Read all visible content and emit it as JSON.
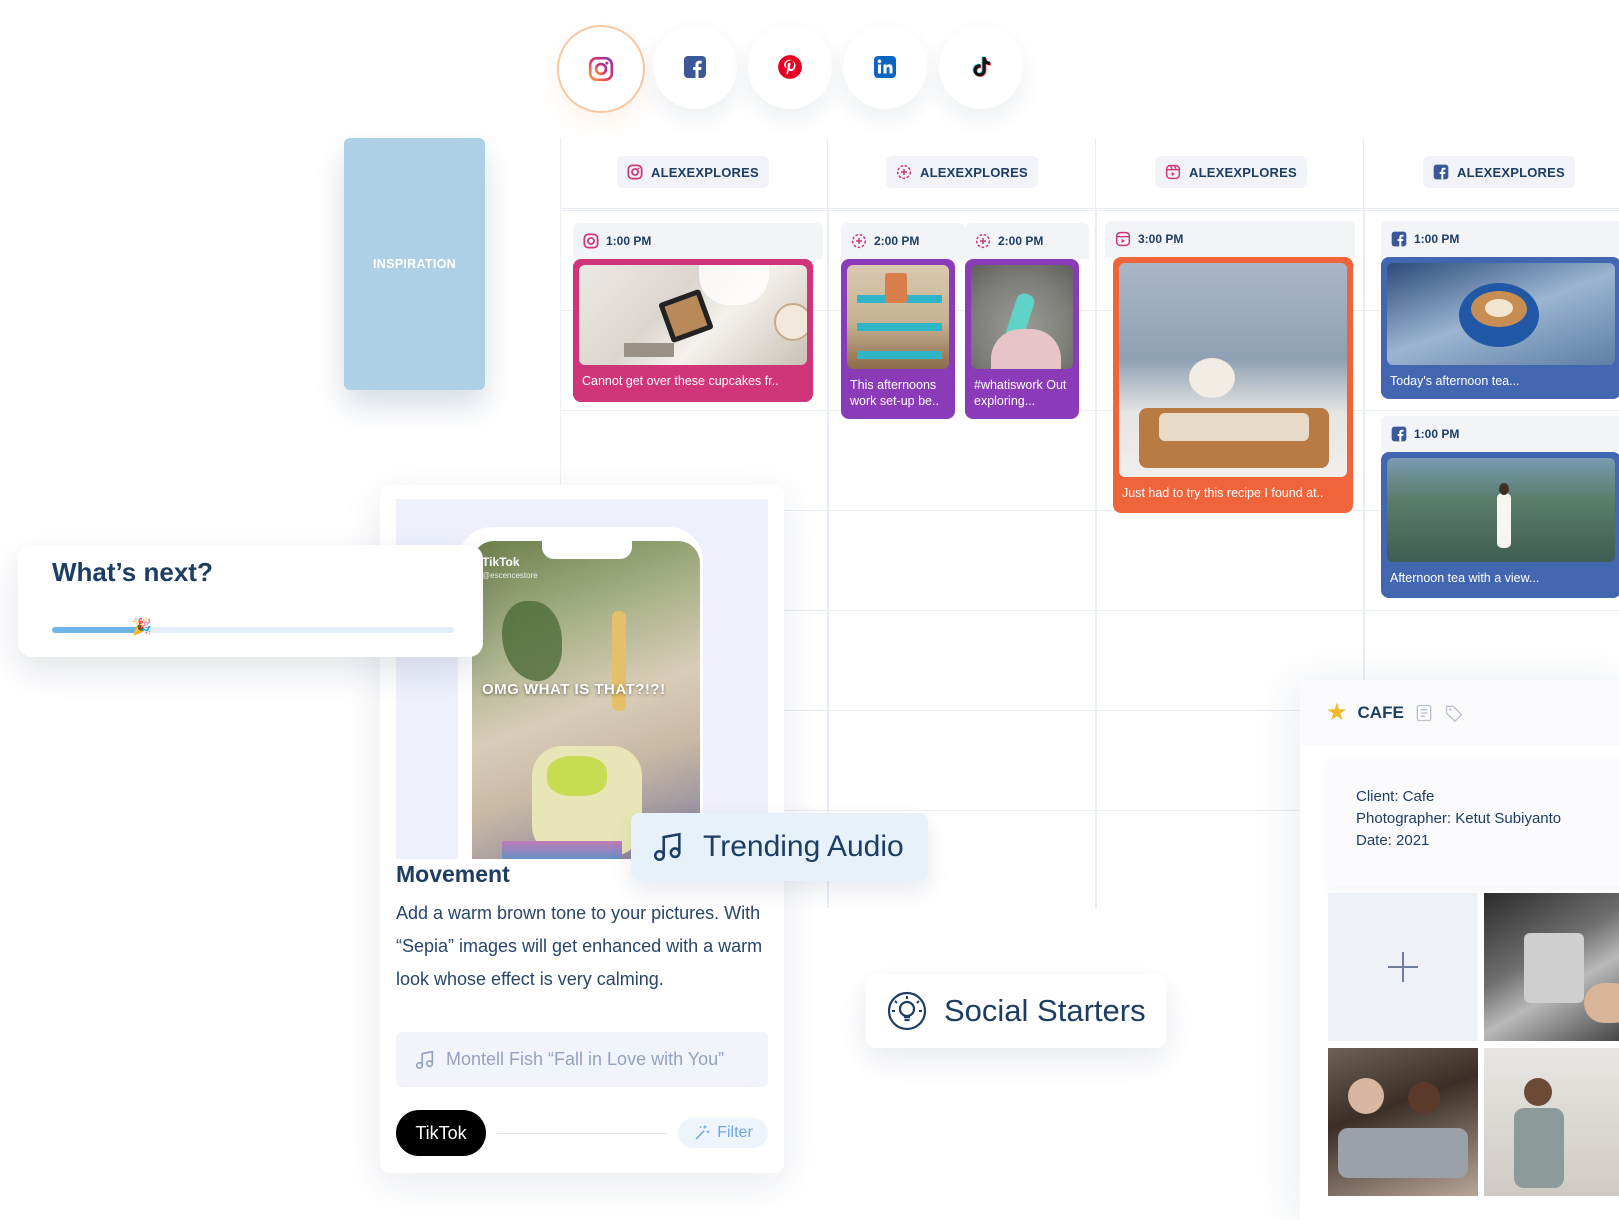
{
  "social_icons": [
    {
      "name": "instagram",
      "icon": "instagram-icon",
      "active": true
    },
    {
      "name": "facebook",
      "icon": "facebook-icon",
      "active": false
    },
    {
      "name": "pinterest",
      "icon": "pinterest-icon",
      "active": false
    },
    {
      "name": "linkedin",
      "icon": "linkedin-icon",
      "active": false
    },
    {
      "name": "tiktok",
      "icon": "tiktok-icon",
      "active": false
    }
  ],
  "inspiration": {
    "label": "INSPIRATION"
  },
  "calendar": {
    "columns": [
      {
        "account": "ALEXEXPLORES",
        "icon": "instagram-icon"
      },
      {
        "account": "ALEXEXPLORES",
        "icon": "story-icon"
      },
      {
        "account": "ALEXEXPLORES",
        "icon": "reels-icon"
      },
      {
        "account": "ALEXEXPLORES",
        "icon": "facebook-icon"
      }
    ],
    "posts": [
      {
        "time": "1:00 PM",
        "caption": "Cannot get over these cupcakes fr..",
        "icon": "instagram-icon",
        "color": "#d0357a"
      },
      {
        "time": "2:00 PM",
        "caption": "This afternoons work set-up be..",
        "icon": "story-icon",
        "color": "#8b3ab8"
      },
      {
        "time": "2:00 PM",
        "caption": "#whatiswork Out exploring...",
        "icon": "story-icon",
        "color": "#8b3ab8"
      },
      {
        "time": "3:00 PM",
        "caption": "Just had to try this recipe I found at..",
        "icon": "reels-icon",
        "color": "#f0643c"
      },
      {
        "time": "1:00 PM",
        "caption": "Today's afternoon tea...",
        "icon": "facebook-icon",
        "color": "#4366b0"
      },
      {
        "time": "1:00 PM",
        "caption": "Afternoon tea with a view...",
        "icon": "facebook-icon",
        "color": "#4366b0"
      }
    ]
  },
  "whats_next": {
    "title": "What’s next?",
    "progress": 0.22,
    "emoji": "🎉"
  },
  "tiktok_card": {
    "overlay_brand": "TikTok",
    "overlay_handle": "@escencestore",
    "overlay_text": "OMG WHAT IS THAT?!?!",
    "title": "Movement",
    "description": "Add a warm brown tone to your pictures. With “Sepia” images will get enhanced with a warm look whose effect is very calming.",
    "audio": "Montell Fish “Fall in Love with You”",
    "platform_badge": "TikTok",
    "filter_label": "Filter"
  },
  "trending_audio": {
    "label": "Trending Audio"
  },
  "social_starters": {
    "label": "Social Starters"
  },
  "cafe": {
    "title": "CAFE",
    "client": "Client: Cafe",
    "photographer": "Photographer: Ketut Subiyanto",
    "date": "Date: 2021"
  },
  "colors": {
    "navy": "#1d3d63",
    "instagram": "#d0357a",
    "story": "#8b3ab8",
    "reels": "#f0643c",
    "facebook": "#4366b0",
    "inspiration": "#aed0e6",
    "progress": "#6fb6e8"
  }
}
